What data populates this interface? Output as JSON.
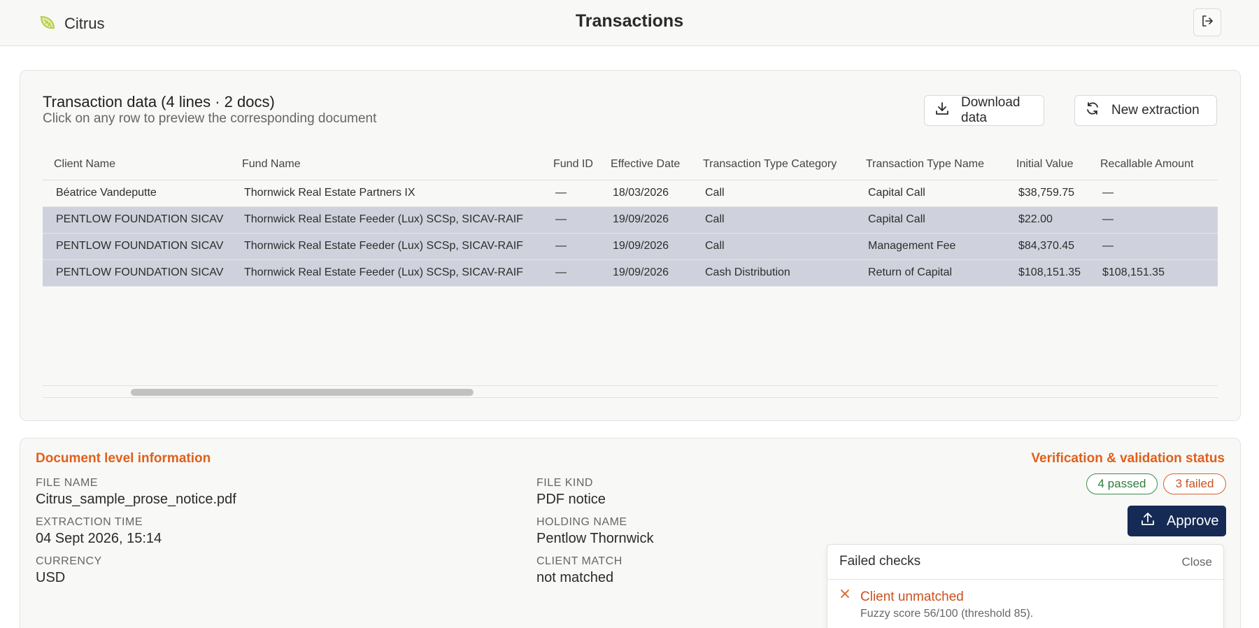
{
  "header": {
    "brand": "Citrus",
    "title": "Transactions"
  },
  "transactions": {
    "title": "Transaction data (4 lines · 2 docs)",
    "subtitle": "Click on any row to preview the corresponding document",
    "download_label": "Download data",
    "new_extraction_label": "New extraction",
    "columns": [
      "Client Name",
      "Fund Name",
      "Fund ID",
      "Effective Date",
      "Transaction Type Category",
      "Transaction Type Name",
      "Initial Value",
      "Recallable Amount"
    ],
    "rows": [
      {
        "selected": false,
        "cells": [
          "Béatrice Vandeputte",
          "Thornwick Real Estate Partners IX",
          "—",
          "18/03/2026",
          "Call",
          "Capital Call",
          "$38,759.75",
          "—"
        ]
      },
      {
        "selected": true,
        "cells": [
          "PENTLOW FOUNDATION SICAV",
          "Thornwick Real Estate Feeder (Lux) SCSp, SICAV-RAIF",
          "—",
          "19/09/2026",
          "Call",
          "Capital Call",
          "$22.00",
          "—"
        ]
      },
      {
        "selected": true,
        "cells": [
          "PENTLOW FOUNDATION SICAV",
          "Thornwick Real Estate Feeder (Lux) SCSp, SICAV-RAIF",
          "—",
          "19/09/2026",
          "Call",
          "Management Fee",
          "$84,370.45",
          "—"
        ]
      },
      {
        "selected": true,
        "cells": [
          "PENTLOW FOUNDATION SICAV",
          "Thornwick Real Estate Feeder (Lux) SCSp, SICAV-RAIF",
          "—",
          "19/09/2026",
          "Cash Distribution",
          "Return of Capital",
          "$108,151.35",
          "$108,151.35"
        ]
      }
    ]
  },
  "document": {
    "section_title": "Document level information",
    "file_name_label": "FILE NAME",
    "file_name": "Citrus_sample_prose_notice.pdf",
    "extraction_time_label": "EXTRACTION TIME",
    "extraction_time": "04 Sept 2026, 15:14",
    "currency_label": "CURRENCY",
    "currency": "USD",
    "file_kind_label": "FILE KIND",
    "file_kind": "PDF notice",
    "holding_name_label": "HOLDING NAME",
    "holding_name": "Pentlow Thornwick",
    "client_match_label": "CLIENT MATCH",
    "client_match": "not matched"
  },
  "verification": {
    "title": "Verification & validation status",
    "passed_badge": "4 passed",
    "failed_badge": "3 failed",
    "approve_label": "Approve"
  },
  "failed_checks": {
    "title": "Failed checks",
    "close_label": "Close",
    "items": [
      {
        "title": "Client unmatched",
        "detail": "Fuzzy score 56/100 (threshold 85)."
      }
    ]
  },
  "colors": {
    "accent_orange": "#e0601a",
    "approve_navy": "#152a54",
    "selected_row": "#cfd2dc",
    "pass_green": "#2f7d3c",
    "fail_orange": "#c9531f"
  }
}
